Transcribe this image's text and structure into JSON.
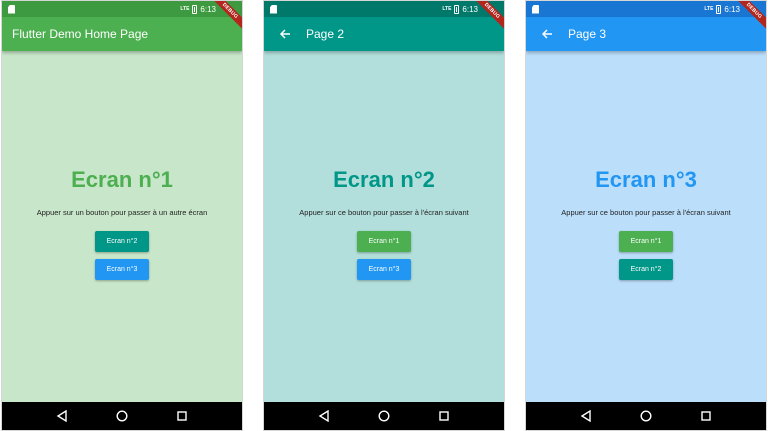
{
  "status_bar": {
    "time": "6:13",
    "network": "LTE"
  },
  "debug_label": "DEBUG",
  "colors": {
    "green": "#4caf50",
    "teal": "#009688",
    "blue": "#2196f3",
    "green_bg": "#c8e6c9",
    "teal_bg": "#b2dfdb",
    "blue_bg": "#bbdefb"
  },
  "screens": [
    {
      "app_bar_title": "Flutter Demo Home Page",
      "has_back": false,
      "heading": "Ecran n°1",
      "instruction": "Appuer sur un bouton pour passer à un autre écran",
      "buttons": [
        {
          "label": "Ecran n°2",
          "color": "#009688"
        },
        {
          "label": "Ecran n°3",
          "color": "#2196f3"
        }
      ]
    },
    {
      "app_bar_title": "Page 2",
      "has_back": true,
      "heading": "Ecran n°2",
      "instruction": "Appuer sur ce bouton pour passer à l'écran suivant",
      "buttons": [
        {
          "label": "Ecran n°1",
          "color": "#4caf50"
        },
        {
          "label": "Ecran n°3",
          "color": "#2196f3"
        }
      ]
    },
    {
      "app_bar_title": "Page 3",
      "has_back": true,
      "heading": "Ecran n°3",
      "instruction": "Appuer sur ce bouton pour passer à l'écran suivant",
      "buttons": [
        {
          "label": "Ecran n°1",
          "color": "#4caf50"
        },
        {
          "label": "Ecran n°2",
          "color": "#009688"
        }
      ]
    }
  ],
  "icons": {
    "back": "arrow-left-icon",
    "nav_back": "triangle-back-icon",
    "nav_home": "circle-home-icon",
    "nav_recents": "square-recents-icon"
  }
}
